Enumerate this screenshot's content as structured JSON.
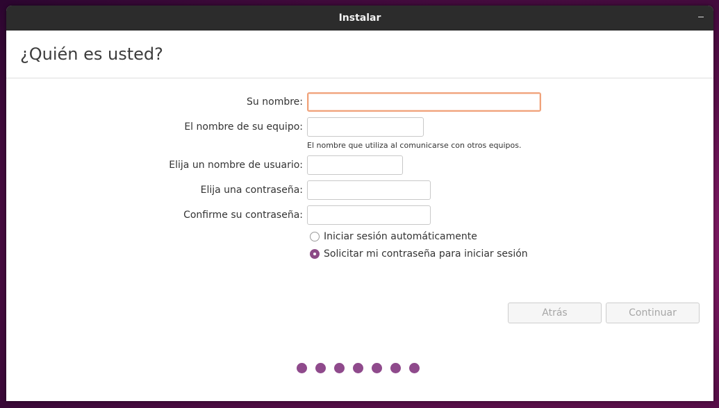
{
  "window": {
    "title": "Instalar"
  },
  "header": {
    "page_title": "¿Quién es usted?"
  },
  "form": {
    "name_label": "Su nombre:",
    "name_value": "",
    "computer_label": "El nombre de su equipo:",
    "computer_value": "",
    "computer_hint": "El nombre que utiliza al comunicarse con otros equipos.",
    "username_label": "Elija un nombre de usuario:",
    "username_value": "",
    "password_label": "Elija una contraseña:",
    "password_value": "",
    "confirm_label": "Confirme su contraseña:",
    "confirm_value": "",
    "login_options": [
      {
        "label": "Iniciar sesión automáticamente",
        "selected": false
      },
      {
        "label": "Solicitar mi contraseña para iniciar sesión",
        "selected": true
      }
    ]
  },
  "buttons": {
    "back_label": "Atrás",
    "continue_label": "Continuar"
  },
  "progress": {
    "step_count": 7
  },
  "colors": {
    "accent": "#8f4a8c",
    "focus_border": "#f0a27a",
    "titlebar": "#2c2c2c"
  }
}
